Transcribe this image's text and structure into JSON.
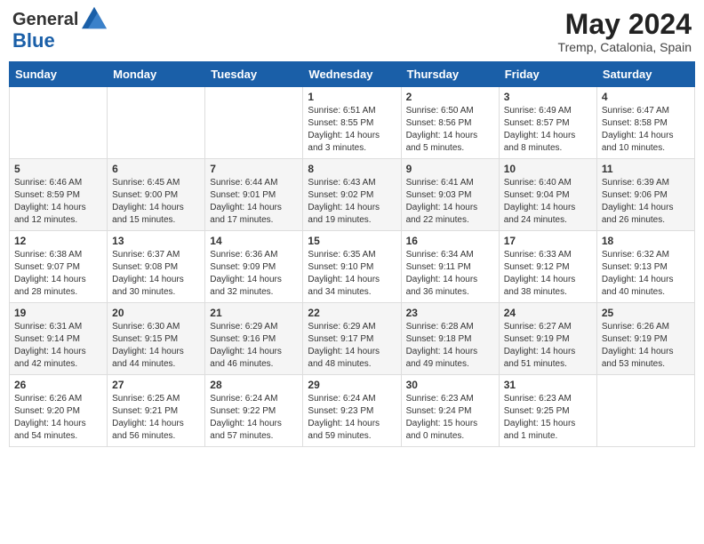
{
  "header": {
    "logo_line1": "General",
    "logo_line2": "Blue",
    "month_year": "May 2024",
    "location": "Tremp, Catalonia, Spain"
  },
  "weekdays": [
    "Sunday",
    "Monday",
    "Tuesday",
    "Wednesday",
    "Thursday",
    "Friday",
    "Saturday"
  ],
  "weeks": [
    [
      {
        "day": "",
        "sunrise": "",
        "sunset": "",
        "daylight": ""
      },
      {
        "day": "",
        "sunrise": "",
        "sunset": "",
        "daylight": ""
      },
      {
        "day": "",
        "sunrise": "",
        "sunset": "",
        "daylight": ""
      },
      {
        "day": "1",
        "sunrise": "Sunrise: 6:51 AM",
        "sunset": "Sunset: 8:55 PM",
        "daylight": "Daylight: 14 hours and 3 minutes."
      },
      {
        "day": "2",
        "sunrise": "Sunrise: 6:50 AM",
        "sunset": "Sunset: 8:56 PM",
        "daylight": "Daylight: 14 hours and 5 minutes."
      },
      {
        "day": "3",
        "sunrise": "Sunrise: 6:49 AM",
        "sunset": "Sunset: 8:57 PM",
        "daylight": "Daylight: 14 hours and 8 minutes."
      },
      {
        "day": "4",
        "sunrise": "Sunrise: 6:47 AM",
        "sunset": "Sunset: 8:58 PM",
        "daylight": "Daylight: 14 hours and 10 minutes."
      }
    ],
    [
      {
        "day": "5",
        "sunrise": "Sunrise: 6:46 AM",
        "sunset": "Sunset: 8:59 PM",
        "daylight": "Daylight: 14 hours and 12 minutes."
      },
      {
        "day": "6",
        "sunrise": "Sunrise: 6:45 AM",
        "sunset": "Sunset: 9:00 PM",
        "daylight": "Daylight: 14 hours and 15 minutes."
      },
      {
        "day": "7",
        "sunrise": "Sunrise: 6:44 AM",
        "sunset": "Sunset: 9:01 PM",
        "daylight": "Daylight: 14 hours and 17 minutes."
      },
      {
        "day": "8",
        "sunrise": "Sunrise: 6:43 AM",
        "sunset": "Sunset: 9:02 PM",
        "daylight": "Daylight: 14 hours and 19 minutes."
      },
      {
        "day": "9",
        "sunrise": "Sunrise: 6:41 AM",
        "sunset": "Sunset: 9:03 PM",
        "daylight": "Daylight: 14 hours and 22 minutes."
      },
      {
        "day": "10",
        "sunrise": "Sunrise: 6:40 AM",
        "sunset": "Sunset: 9:04 PM",
        "daylight": "Daylight: 14 hours and 24 minutes."
      },
      {
        "day": "11",
        "sunrise": "Sunrise: 6:39 AM",
        "sunset": "Sunset: 9:06 PM",
        "daylight": "Daylight: 14 hours and 26 minutes."
      }
    ],
    [
      {
        "day": "12",
        "sunrise": "Sunrise: 6:38 AM",
        "sunset": "Sunset: 9:07 PM",
        "daylight": "Daylight: 14 hours and 28 minutes."
      },
      {
        "day": "13",
        "sunrise": "Sunrise: 6:37 AM",
        "sunset": "Sunset: 9:08 PM",
        "daylight": "Daylight: 14 hours and 30 minutes."
      },
      {
        "day": "14",
        "sunrise": "Sunrise: 6:36 AM",
        "sunset": "Sunset: 9:09 PM",
        "daylight": "Daylight: 14 hours and 32 minutes."
      },
      {
        "day": "15",
        "sunrise": "Sunrise: 6:35 AM",
        "sunset": "Sunset: 9:10 PM",
        "daylight": "Daylight: 14 hours and 34 minutes."
      },
      {
        "day": "16",
        "sunrise": "Sunrise: 6:34 AM",
        "sunset": "Sunset: 9:11 PM",
        "daylight": "Daylight: 14 hours and 36 minutes."
      },
      {
        "day": "17",
        "sunrise": "Sunrise: 6:33 AM",
        "sunset": "Sunset: 9:12 PM",
        "daylight": "Daylight: 14 hours and 38 minutes."
      },
      {
        "day": "18",
        "sunrise": "Sunrise: 6:32 AM",
        "sunset": "Sunset: 9:13 PM",
        "daylight": "Daylight: 14 hours and 40 minutes."
      }
    ],
    [
      {
        "day": "19",
        "sunrise": "Sunrise: 6:31 AM",
        "sunset": "Sunset: 9:14 PM",
        "daylight": "Daylight: 14 hours and 42 minutes."
      },
      {
        "day": "20",
        "sunrise": "Sunrise: 6:30 AM",
        "sunset": "Sunset: 9:15 PM",
        "daylight": "Daylight: 14 hours and 44 minutes."
      },
      {
        "day": "21",
        "sunrise": "Sunrise: 6:29 AM",
        "sunset": "Sunset: 9:16 PM",
        "daylight": "Daylight: 14 hours and 46 minutes."
      },
      {
        "day": "22",
        "sunrise": "Sunrise: 6:29 AM",
        "sunset": "Sunset: 9:17 PM",
        "daylight": "Daylight: 14 hours and 48 minutes."
      },
      {
        "day": "23",
        "sunrise": "Sunrise: 6:28 AM",
        "sunset": "Sunset: 9:18 PM",
        "daylight": "Daylight: 14 hours and 49 minutes."
      },
      {
        "day": "24",
        "sunrise": "Sunrise: 6:27 AM",
        "sunset": "Sunset: 9:19 PM",
        "daylight": "Daylight: 14 hours and 51 minutes."
      },
      {
        "day": "25",
        "sunrise": "Sunrise: 6:26 AM",
        "sunset": "Sunset: 9:19 PM",
        "daylight": "Daylight: 14 hours and 53 minutes."
      }
    ],
    [
      {
        "day": "26",
        "sunrise": "Sunrise: 6:26 AM",
        "sunset": "Sunset: 9:20 PM",
        "daylight": "Daylight: 14 hours and 54 minutes."
      },
      {
        "day": "27",
        "sunrise": "Sunrise: 6:25 AM",
        "sunset": "Sunset: 9:21 PM",
        "daylight": "Daylight: 14 hours and 56 minutes."
      },
      {
        "day": "28",
        "sunrise": "Sunrise: 6:24 AM",
        "sunset": "Sunset: 9:22 PM",
        "daylight": "Daylight: 14 hours and 57 minutes."
      },
      {
        "day": "29",
        "sunrise": "Sunrise: 6:24 AM",
        "sunset": "Sunset: 9:23 PM",
        "daylight": "Daylight: 14 hours and 59 minutes."
      },
      {
        "day": "30",
        "sunrise": "Sunrise: 6:23 AM",
        "sunset": "Sunset: 9:24 PM",
        "daylight": "Daylight: 15 hours and 0 minutes."
      },
      {
        "day": "31",
        "sunrise": "Sunrise: 6:23 AM",
        "sunset": "Sunset: 9:25 PM",
        "daylight": "Daylight: 15 hours and 1 minute."
      },
      {
        "day": "",
        "sunrise": "",
        "sunset": "",
        "daylight": ""
      }
    ]
  ]
}
